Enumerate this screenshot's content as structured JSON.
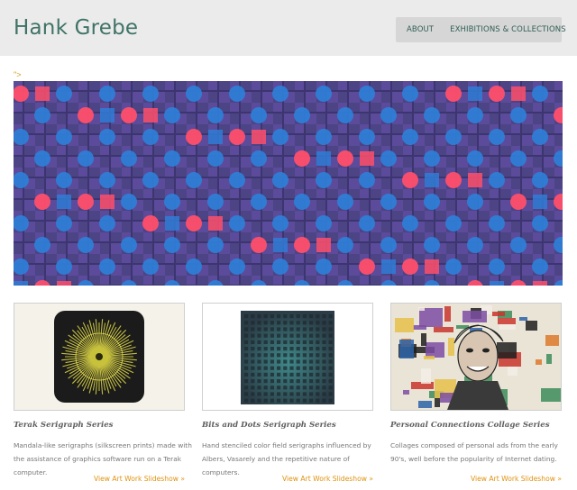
{
  "site": {
    "title": "Hank Grebe"
  },
  "nav": {
    "items": [
      "ABOUT",
      "EXHIBITIONS & COLLECTIONS"
    ]
  },
  "broken_image_text": "\">",
  "cards": [
    {
      "title": "Terak Serigraph Series",
      "description": "Mandala-like serigraphs (silkscreen prints) made with the assistance of graphics software run on a Terak computer.",
      "link": "View Art Work Slideshow »"
    },
    {
      "title": "Bits and Dots Serigraph Series",
      "description": "Hand stenciled color field serigraphs influenced by Albers, Vasarely and the repetitive nature of computers.",
      "link": "View Art Work Slideshow »"
    },
    {
      "title": "Personal Connections Collage Series",
      "description": "Collages composed of personal ads from the early 90's, well before the popularity of Internet dating.",
      "link": "View Art Work Slideshow »"
    }
  ],
  "colors": {
    "title": "#3f7366",
    "nav_bg": "#d6d6d6",
    "link": "#e0920e",
    "banner_purple": "#4c4485",
    "banner_blue": "#2f7dd6",
    "banner_red": "#ff4f6a"
  }
}
